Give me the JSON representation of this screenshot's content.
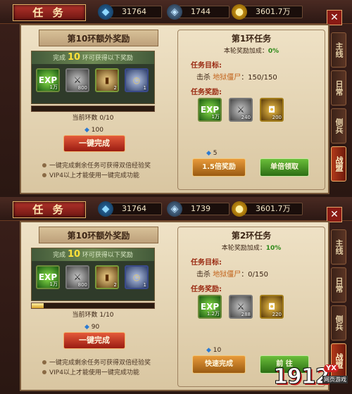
{
  "screens": [
    {
      "title": "任 务",
      "resources": {
        "diamond": "31764",
        "bound_diamond": "1744",
        "gold": "3601.7万"
      },
      "left": {
        "header": "第10环额外奖励",
        "reward_head_pre": "完成",
        "reward_head_num": "10",
        "reward_head_post": "环可获得以下奖励",
        "items": [
          {
            "icon": "exp-icon",
            "glyph": "EXP",
            "count": "1万"
          },
          {
            "icon": "shield-icon",
            "glyph": "⚔",
            "count": "800"
          },
          {
            "icon": "scroll-icon",
            "glyph": "▮",
            "count": "2"
          },
          {
            "icon": "pocket-watch-icon",
            "glyph": "◷",
            "count": "1"
          }
        ],
        "progress_label": "当前环数 0/10",
        "progress_fraction": 0.0,
        "cost": "100",
        "button": "一键完成",
        "tips": [
          "一键完成剩余任务可获得双倍经验奖",
          "VIP4以上才能使用一键完成功能"
        ]
      },
      "right": {
        "title": "第1环任务",
        "bonus_label": "本轮奖励加成：",
        "bonus_value": "0%",
        "target_label": "任务目标:",
        "target_pre": "击杀",
        "target_monster": "地狱僵尸",
        "target_progress": "：150/150",
        "reward_label": "任务奖励:",
        "items": [
          {
            "icon": "exp-icon",
            "glyph": "EXP",
            "count": "1万"
          },
          {
            "icon": "shield-icon",
            "glyph": "⚔",
            "count": "240"
          },
          {
            "icon": "rune-icon",
            "glyph": "◘",
            "count": "200"
          }
        ],
        "cost": "5",
        "btn_left": "1.5倍奖励",
        "btn_right": "单倍领取"
      }
    },
    {
      "title": "任 务",
      "resources": {
        "diamond": "31764",
        "bound_diamond": "1739",
        "gold": "3601.7万"
      },
      "left": {
        "header": "第10环额外奖励",
        "reward_head_pre": "完成",
        "reward_head_num": "10",
        "reward_head_post": "环可获得以下奖励",
        "items": [
          {
            "icon": "exp-icon",
            "glyph": "EXP",
            "count": "1万"
          },
          {
            "icon": "shield-icon",
            "glyph": "⚔",
            "count": "800"
          },
          {
            "icon": "scroll-icon",
            "glyph": "▮",
            "count": "2"
          },
          {
            "icon": "pocket-watch-icon",
            "glyph": "◷",
            "count": "1"
          }
        ],
        "progress_label": "当前环数 1/10",
        "progress_fraction": 0.1,
        "cost": "90",
        "button": "一键完成",
        "tips": [
          "一键完成剩余任务可获得双倍经验奖",
          "VIP4以上才能使用一键完成功能"
        ]
      },
      "right": {
        "title": "第2环任务",
        "bonus_label": "本轮奖励加成：",
        "bonus_value": "10%",
        "target_label": "任务目标:",
        "target_pre": "击杀",
        "target_monster": "地狱僵尸",
        "target_progress": "：0/150",
        "reward_label": "任务奖励:",
        "items": [
          {
            "icon": "exp-icon",
            "glyph": "EXP",
            "count": "1.2万"
          },
          {
            "icon": "shield-icon",
            "glyph": "⚔",
            "count": "288"
          },
          {
            "icon": "rune-icon",
            "glyph": "◘",
            "count": "220"
          }
        ],
        "cost": "10",
        "btn_left": "快速完成",
        "btn_right": "前 往"
      }
    }
  ],
  "side_tabs": [
    "主线",
    "日常",
    "侧兵",
    "战盟"
  ],
  "active_side_tab": 3,
  "watermark": {
    "num": "1912",
    "yx": "YX",
    "sub": "网页游戏"
  }
}
